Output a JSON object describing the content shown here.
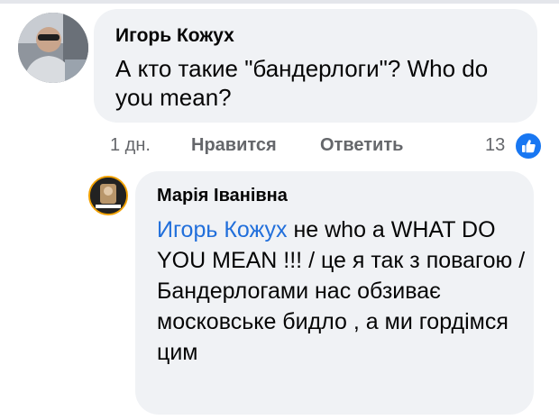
{
  "comment": {
    "author": "Игорь Кожух",
    "text": "А кто такие \"бандерлоги\"? Who do you mean?"
  },
  "actions": {
    "time": "1 дн.",
    "like": "Нравится",
    "reply": "Ответить",
    "reaction_count": "13"
  },
  "reply_comment": {
    "author": "Марія Іванівна",
    "mention": "Игорь Кожух",
    "text": " не who a WHAT DO YOU MEAN !!! / це я так з повагою / Бандерлогами нас обзиває московське бидло , а ми гордімся цим"
  },
  "colors": {
    "bubble": "#f0f2f5",
    "mention": "#216fdb",
    "like_badge": "#1877f2"
  }
}
